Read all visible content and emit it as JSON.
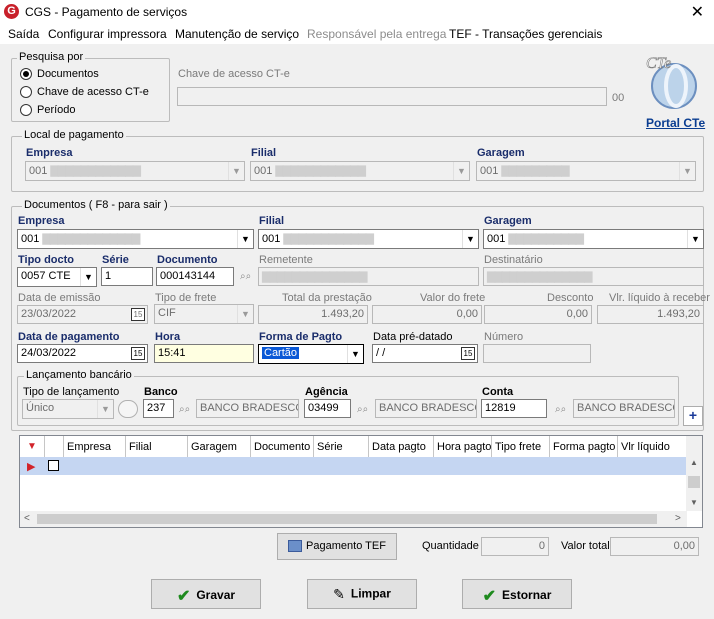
{
  "window": {
    "title": "CGS - Pagamento de serviços",
    "icon_letter": "G"
  },
  "menu": [
    "Saída",
    "Configurar impressora",
    "Manutenção de serviço",
    "Responsável pela entrega",
    "TEF - Transações gerenciais"
  ],
  "pesquisa": {
    "legend": "Pesquisa por",
    "options": [
      "Documentos",
      "Chave de acesso CT-e",
      "Período"
    ],
    "selected": 0,
    "chave_label": "Chave de acesso CT-e",
    "chave_value": "",
    "chave_suffix": "00"
  },
  "cte": {
    "logo_text": "CTe",
    "portal_link": "Portal CTe"
  },
  "local_pagamento": {
    "legend": "Local de pagamento",
    "empresa_label": "Empresa",
    "empresa_value": "001",
    "filial_label": "Filial",
    "filial_value": "001",
    "garagem_label": "Garagem",
    "garagem_value": "001"
  },
  "documentos": {
    "legend": "Documentos ( F8 - para sair )",
    "empresa_label": "Empresa",
    "empresa_value": "001",
    "filial_label": "Filial",
    "filial_value": "001",
    "garagem_label": "Garagem",
    "garagem_value": "001",
    "tipo_docto_label": "Tipo docto",
    "tipo_docto_value": "0057 CTE",
    "serie_label": "Série",
    "serie_value": "1",
    "documento_label": "Documento",
    "documento_value": "000143144",
    "remetente_label": "Remetente",
    "destinatario_label": "Destinatário",
    "data_emissao_label": "Data de emissão",
    "data_emissao_value": "23/03/2022",
    "tipo_frete_label": "Tipo de frete",
    "tipo_frete_value": "CIF",
    "total_prestacao_label": "Total da prestação",
    "total_prestacao_value": "1.493,20",
    "valor_frete_label": "Valor do frete",
    "valor_frete_value": "0,00",
    "desconto_label": "Desconto",
    "desconto_value": "0,00",
    "liquido_label": "Vlr. líquido à receber",
    "liquido_value": "1.493,20",
    "data_pagamento_label": "Data de pagamento",
    "data_pagamento_value": "24/03/2022",
    "hora_label": "Hora",
    "hora_value": "15:41",
    "forma_pagto_label": "Forma de Pagto",
    "forma_pagto_value": "Cartão",
    "data_predatado_label": "Data pré-datado",
    "data_predatado_value": "/ /",
    "numero_label": "Número",
    "numero_value": "",
    "cal_icon": "15"
  },
  "lancamento": {
    "legend": "Lançamento bancário",
    "tipo_label": "Tipo de lançamento",
    "tipo_value": "Único",
    "banco_label": "Banco",
    "banco_code": "237",
    "banco_name": "BANCO BRADESCO",
    "agencia_label": "Agência",
    "agencia_code": "03499",
    "agencia_name": "BANCO BRADESCO",
    "conta_label": "Conta",
    "conta_code": "12819",
    "conta_name": "BANCO BRADESCO",
    "add_icon": "+"
  },
  "grid": {
    "columns": [
      "Empresa",
      "Filial",
      "Garagem",
      "Documento",
      "Série",
      "Data pagto",
      "Hora pagto",
      "Tipo frete",
      "Forma pagto",
      "Vlr líquido"
    ]
  },
  "footer": {
    "tef_button": "Pagamento TEF",
    "quantidade_label": "Quantidade",
    "quantidade_value": "0",
    "valor_total_label": "Valor total",
    "valor_total_value": "0,00",
    "gravar": "Gravar",
    "limpar": "Limpar",
    "estornar": "Estornar"
  }
}
